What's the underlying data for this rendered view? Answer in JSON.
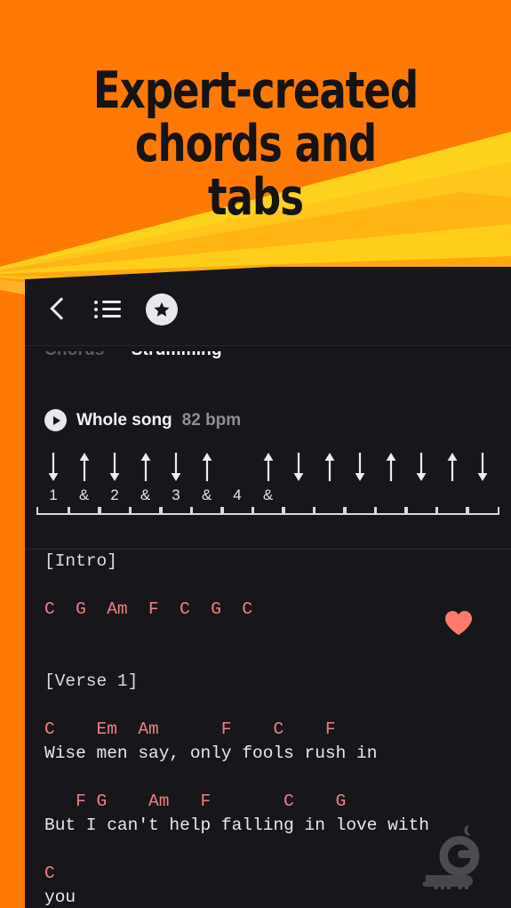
{
  "promo": {
    "background_color": "#FF7A05",
    "headline_lines": [
      "Expert-created",
      "chords and",
      "tabs"
    ],
    "headline_color": "#141414",
    "ray_colors": [
      "#FFD21E",
      "#FFC21A",
      "#FFB114",
      "#FFA30F",
      "#FF9A22",
      "#FF8A3D",
      "#FF7A5C",
      "#FF6B73",
      "#FF5C7A"
    ]
  },
  "app": {
    "panel_background": "#17171B",
    "appbar": {
      "back_icon": "chevron-left-icon",
      "list_icon": "bulleted-list-icon",
      "favorite_icon": "star-circle-icon"
    },
    "tabs": [
      {
        "label": "Chords",
        "active": false
      },
      {
        "label": "Strumming",
        "active": true
      }
    ],
    "player": {
      "play_icon": "play-circle-icon",
      "scope_label": "Whole song",
      "tempo_label": "82 bpm",
      "tempo_value": 82,
      "tempo_unit": "bpm"
    },
    "strumming": {
      "beats": [
        {
          "dir": "down",
          "label": "1"
        },
        {
          "dir": "up",
          "label": "&"
        },
        {
          "dir": "down",
          "label": "2"
        },
        {
          "dir": "up",
          "label": "&"
        },
        {
          "dir": "down",
          "label": "3"
        },
        {
          "dir": "up",
          "label": "&"
        },
        {
          "dir": "none",
          "label": "4"
        },
        {
          "dir": "up",
          "label": "&"
        },
        {
          "dir": "down",
          "label": ""
        },
        {
          "dir": "up",
          "label": ""
        },
        {
          "dir": "down",
          "label": ""
        },
        {
          "dir": "up",
          "label": ""
        },
        {
          "dir": "down",
          "label": ""
        },
        {
          "dir": "up",
          "label": ""
        },
        {
          "dir": "down",
          "label": ""
        }
      ]
    },
    "sheet": {
      "chord_color": "#F08080",
      "lyric_color": "#E8E8ED",
      "lines": [
        {
          "type": "tag",
          "text": "[Intro]"
        },
        {
          "type": "gap",
          "text": ""
        },
        {
          "type": "chord",
          "text": "C  G  Am  F  C  G  C"
        },
        {
          "type": "gap",
          "text": ""
        },
        {
          "type": "gap",
          "text": ""
        },
        {
          "type": "tag",
          "text": "[Verse 1]"
        },
        {
          "type": "gap",
          "text": ""
        },
        {
          "type": "chord",
          "text": "C    Em  Am      F    C    F"
        },
        {
          "type": "lyric",
          "text": "Wise men say, only fools rush in"
        },
        {
          "type": "gap",
          "text": ""
        },
        {
          "type": "chord",
          "text": "   F G    Am   F       C    G"
        },
        {
          "type": "lyric",
          "text": "But I can't help falling in love with"
        },
        {
          "type": "gap",
          "text": ""
        },
        {
          "type": "chord",
          "text": "C"
        },
        {
          "type": "lyric",
          "text": "you"
        }
      ]
    },
    "favorite_heart": {
      "icon": "heart-icon",
      "color": "#FF7A6E"
    }
  },
  "watermark": {
    "icon": "bazaar-logo-watermark",
    "color": "#8C8C92"
  }
}
